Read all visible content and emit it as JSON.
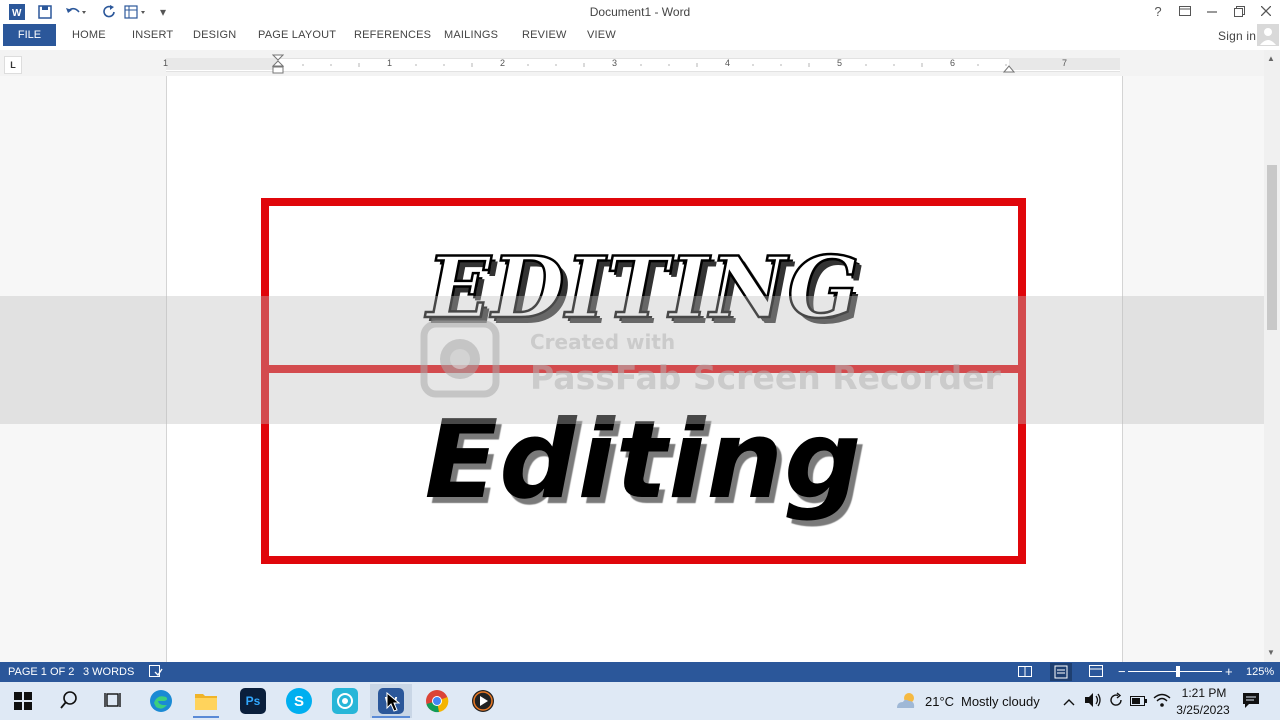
{
  "window": {
    "title": "Document1 - Word"
  },
  "qat": {
    "customize_arrow": "▾"
  },
  "ribbon": {
    "tabs": [
      "FILE",
      "HOME",
      "INSERT",
      "DESIGN",
      "PAGE LAYOUT",
      "REFERENCES",
      "MAILINGS",
      "REVIEW",
      "VIEW"
    ],
    "sign_in": "Sign in",
    "help": "?"
  },
  "ruler": {
    "tab_selector": "L",
    "numbers": [
      "1",
      "1",
      "2",
      "3",
      "4",
      "5",
      "6",
      "7"
    ]
  },
  "document": {
    "line1": "EDITING",
    "line2": "Editing"
  },
  "watermark": {
    "line1": "Created with",
    "line2": "PassFab Screen Recorder"
  },
  "status": {
    "page": "PAGE 1 OF 2",
    "words": "3 WORDS",
    "zoom_level": "125%",
    "zoom_minus": "−",
    "zoom_plus": "+"
  },
  "taskbar": {
    "weather_temp": "21°C",
    "weather_desc": "Mostly cloudy",
    "time": "1:21 PM",
    "date": "3/25/2023",
    "ps_label": "Ps",
    "skype_label": "S",
    "word_label": "W"
  },
  "colors": {
    "word_blue": "#2b579a",
    "box_red": "#e0060b",
    "taskbar_bg": "#dfe9f5"
  }
}
